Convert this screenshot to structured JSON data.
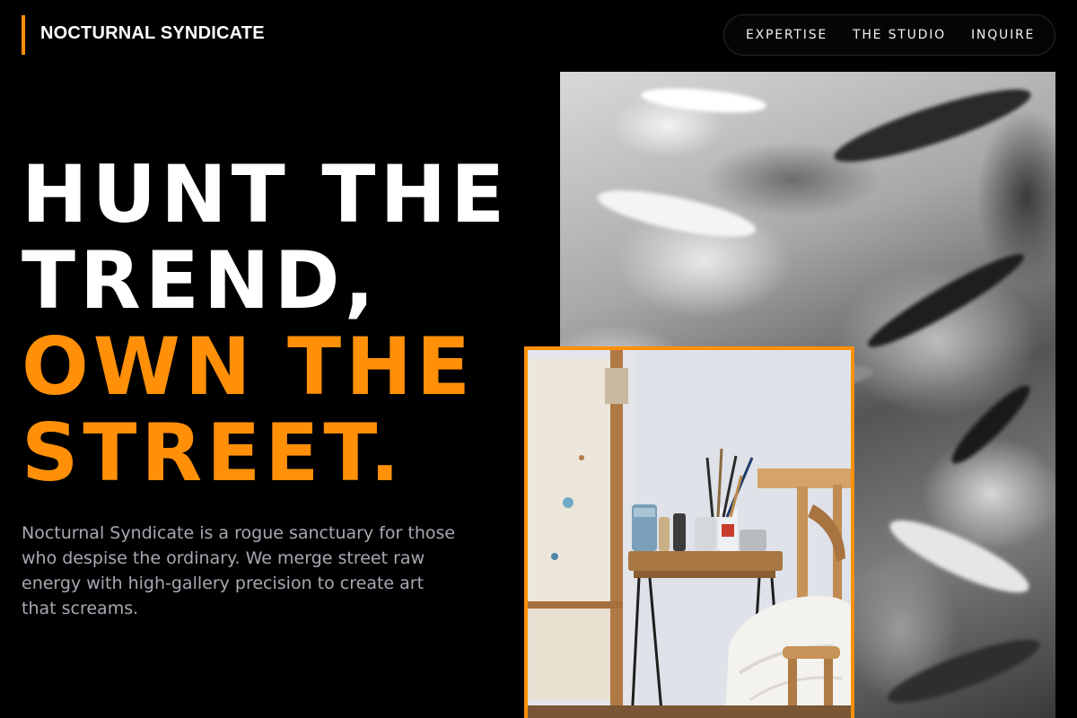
{
  "brand": {
    "name": "NOCTURNAL SYNDICATE",
    "accent_color": "#ff9008"
  },
  "nav": {
    "links": [
      {
        "label": "EXPERTISE"
      },
      {
        "label": "THE STUDIO"
      },
      {
        "label": "INQUIRE"
      }
    ]
  },
  "hero": {
    "headline_lines": [
      {
        "text": "HUNT THE",
        "color": "#ffffff"
      },
      {
        "text": "TREND,",
        "color": "#ffffff"
      },
      {
        "text": "OWN THE",
        "color": "#ff9008"
      },
      {
        "text": "STREET.",
        "color": "#ff9008"
      }
    ],
    "description_lines": [
      "Nocturnal Syndicate is a rogue sanctuary for those",
      "who despise the ordinary. We merge street raw",
      "energy with high-gallery precision to create art",
      "that screams."
    ]
  },
  "images": {
    "texture_icon": "abstract-paint-texture-image",
    "studio_icon": "art-studio-photo"
  }
}
